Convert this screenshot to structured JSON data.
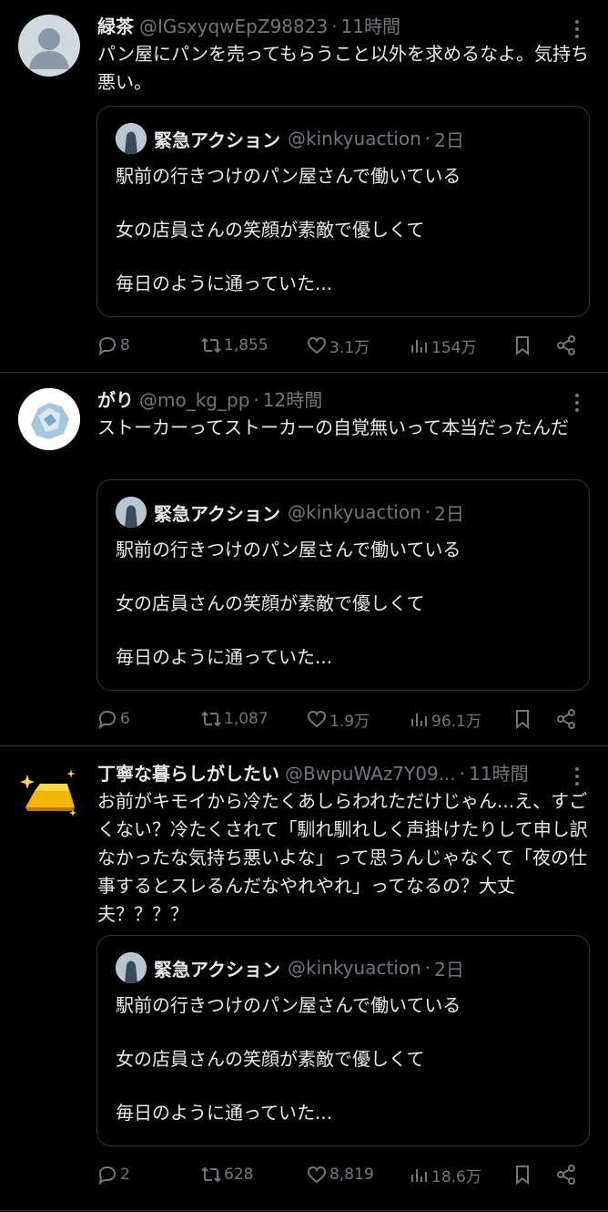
{
  "quoted": {
    "name": "緊急アクション",
    "handle": "@kinkyuaction",
    "time": "2日",
    "lines": [
      "駅前の行きつけのパン屋さんで働いている",
      "女の店員さんの笑顔が素敵で優しくて",
      "毎日のように通っていた..."
    ]
  },
  "tweets": [
    {
      "name": "緑茶",
      "handle": "@IGsxyqwEpZ98823",
      "time": "11時間",
      "text": "パン屋にパンを売ってもらうこと以外を求めるなよ。気持ち悪い。",
      "replies": "8",
      "retweets": "1,855",
      "likes": "3.1万",
      "views": "154万"
    },
    {
      "name": "がり",
      "handle": "@mo_kg_pp",
      "time": "12時間",
      "text": "ストーカーってストーカーの自覚無いって本当だったんだ",
      "replies": "6",
      "retweets": "1,087",
      "likes": "1.9万",
      "views": "96.1万"
    },
    {
      "name": "丁寧な暮らしがしたい",
      "handle": "@BwpuWAz7Y09...",
      "time": "11時間",
      "text": "お前がキモイから冷たくあしらわれただけじゃん...え、すごくない？冷たくされて「馴れ馴れしく声掛けたりして申し訳なかったな気持ち悪いよな」って思うんじゃなくて「夜の仕事するとスレるんだなやれやれ」ってなるの？大丈夫？？？？",
      "replies": "2",
      "retweets": "628",
      "likes": "8,819",
      "views": "18.6万"
    }
  ],
  "dot": "·",
  "colors": {
    "background": "#000000",
    "text": "#e7e9ea",
    "muted": "#71767b",
    "border": "#2f3336"
  }
}
